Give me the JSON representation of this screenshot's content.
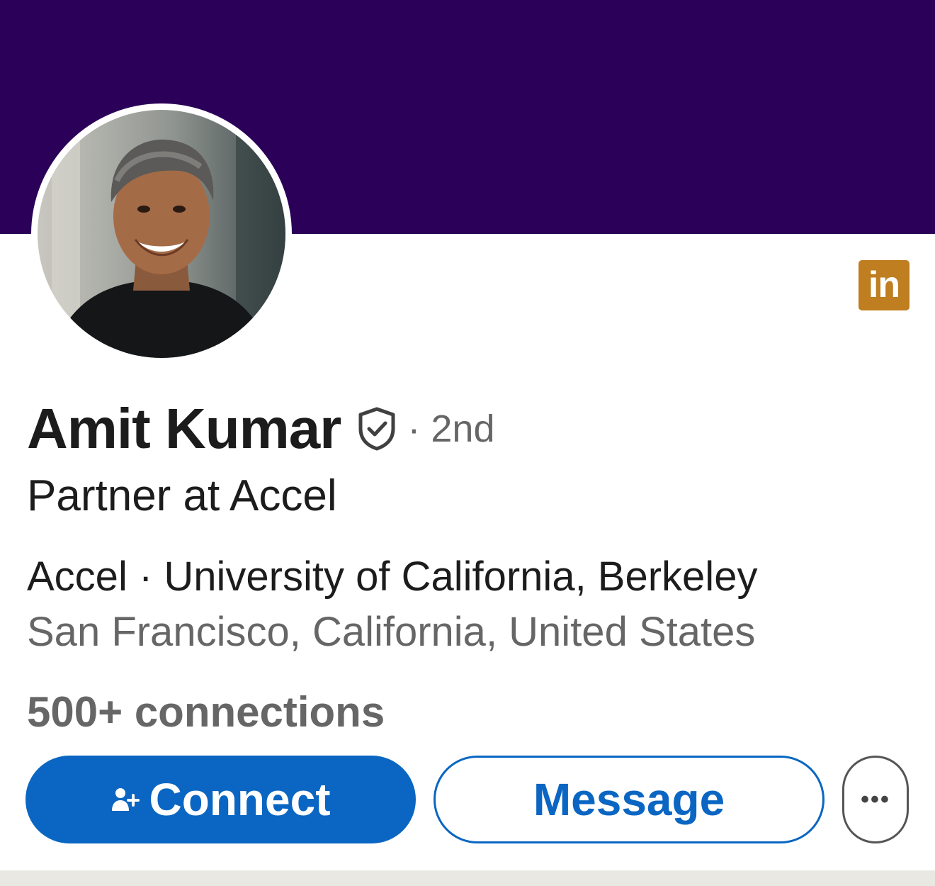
{
  "profile": {
    "name": "Amit Kumar",
    "degree": "· 2nd",
    "headline": "Partner at Accel",
    "affiliation": "Accel · University of California, Berkeley",
    "location": "San Francisco, California, United States",
    "connections": "500+ connections"
  },
  "badge": {
    "label": "in",
    "color": "#bf7e1f"
  },
  "actions": {
    "connect_label": "Connect",
    "message_label": "Message",
    "more_label": "•••"
  },
  "colors": {
    "banner": "#2a0058",
    "accent": "#0a66c2",
    "muted_text": "#666666"
  },
  "icons": {
    "verified": "shield-check-icon",
    "connect": "add-person-icon",
    "more": "ellipsis-icon"
  }
}
